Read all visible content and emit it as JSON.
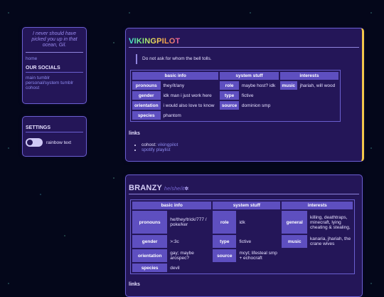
{
  "sidebar": {
    "quote": "I never should have picked you up in that ocean, Gil.",
    "home": "home",
    "socials_heading": "OUR SOCIALS",
    "socials": [
      "main tumblr",
      "personal/system tumblr",
      "cohost"
    ]
  },
  "settings": {
    "heading": "SETTINGS",
    "toggle_label": "rainbow text"
  },
  "card1": {
    "title": "VIKINGPILOT",
    "quote": "Do not ask for whom the bell tolls.",
    "headers": [
      "basic info",
      "system stuff",
      "interests"
    ],
    "basic": [
      {
        "k": "pronouns",
        "v": "they/it/any"
      },
      {
        "k": "gender",
        "v": "idk man i just work here"
      },
      {
        "k": "orientation",
        "v": "i would also love to know"
      },
      {
        "k": "species",
        "v": "phantom"
      }
    ],
    "system": [
      {
        "k": "role",
        "v": "maybe host? idk"
      },
      {
        "k": "type",
        "v": "fictive"
      },
      {
        "k": "source",
        "v": "dominion smp"
      }
    ],
    "interests": [
      {
        "k": "music",
        "v": "jhariah, will wood"
      }
    ],
    "links_title": "links",
    "links": [
      {
        "label": "cohost:",
        "link": "vikingpilot"
      },
      {
        "label": "",
        "link": "spotify playlist"
      }
    ]
  },
  "card2": {
    "title": "BRANZY",
    "subtitle": "he/she/it",
    "star": "✲",
    "headers": [
      "basic info",
      "system stuff",
      "interests"
    ],
    "basic": [
      {
        "k": "pronouns",
        "v": "he/they/trick/777 / poke/ker"
      },
      {
        "k": "gender",
        "v": ">:3c"
      },
      {
        "k": "orientation",
        "v": "gay; maybe arospec?"
      },
      {
        "k": "species",
        "v": "devil"
      }
    ],
    "system": [
      {
        "k": "role",
        "v": "idk"
      },
      {
        "k": "type",
        "v": "fictive"
      },
      {
        "k": "source",
        "v": "mcyt; lifesteal smp + echocraft"
      }
    ],
    "interests": [
      {
        "k": "general",
        "v": "killing, deathtraps, minecraft, lying cheating & stealing,"
      },
      {
        "k": "music",
        "v": "kanaria, jhariah, the crane wives"
      }
    ],
    "links_title": "links"
  }
}
